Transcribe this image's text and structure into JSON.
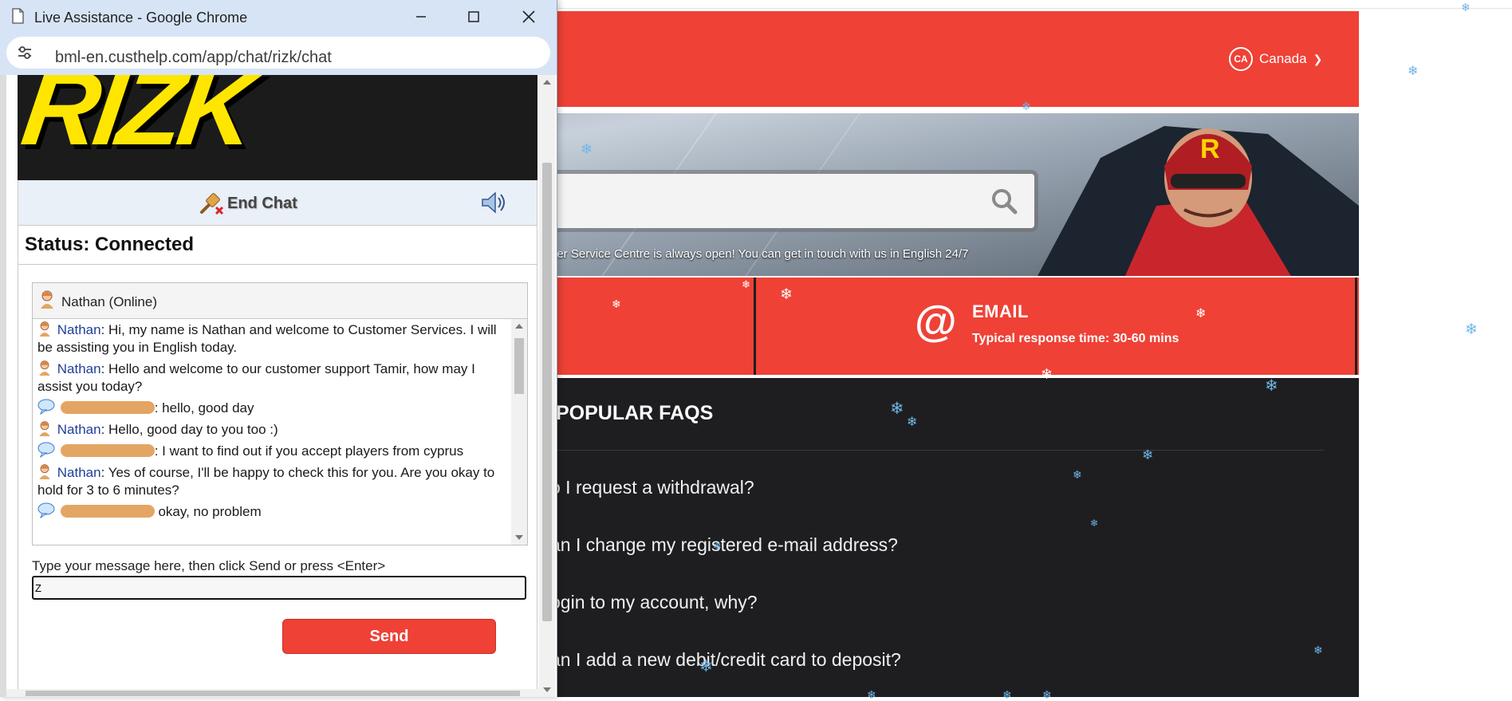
{
  "popup": {
    "window_title": "Live Assistance - Google Chrome",
    "url": "bml-en.custhelp.com/app/chat/rizk/chat",
    "logo_text": "RIZK",
    "end_chat_label": "End Chat",
    "status_text": "Status: Connected",
    "agent_header": "Nathan (Online)",
    "messages": [
      {
        "sender": "Nathan",
        "text": ": Hi, my name is Nathan and welcome to Customer Services. I will be assisting you in English today.",
        "role": "agent"
      },
      {
        "sender": "Nathan",
        "text": ": Hello and welcome to our customer support Tamir, how may I assist you today?",
        "role": "agent"
      },
      {
        "sender": "",
        "text": ": hello, good day",
        "role": "user"
      },
      {
        "sender": "Nathan",
        "text": ": Hello, good day to you too :)",
        "role": "agent"
      },
      {
        "sender": "",
        "text": ": I want to find out if you accept players from cyprus",
        "role": "user"
      },
      {
        "sender": "Nathan",
        "text": ": Yes of course, I'll be happy to check this for you. Are you okay to hold for 3 to 6 minutes?",
        "role": "agent"
      },
      {
        "sender": "",
        "text": " okay, no problem",
        "role": "user"
      }
    ],
    "compose_label": "Type your message here, then click Send or press <Enter>",
    "compose_value": "Z",
    "send_label": "Send",
    "icons": {
      "end_chat": "end-chat-plug-icon",
      "sound": "speaker-icon",
      "agent": "agent-avatar-icon",
      "user": "user-bubble-icon"
    }
  },
  "site": {
    "country_code": "CA",
    "country_label": "Canada",
    "hero_caption": "ner Service Centre is always open! You can get in touch with us in English 24/7",
    "email_title": "EMAIL",
    "email_sub": "Typical response time: 30-60 mins",
    "faq_title": "POPULAR FAQS",
    "faq_items": [
      "o I request a withdrawal?",
      "an I change my registered e-mail address?",
      "ogin to my account, why?",
      "an I add a new debit/credit card to deposit?"
    ],
    "colors": {
      "brand_red": "#ef4136",
      "dark": "#1e1e20",
      "flake": "#6fb6e8"
    }
  }
}
